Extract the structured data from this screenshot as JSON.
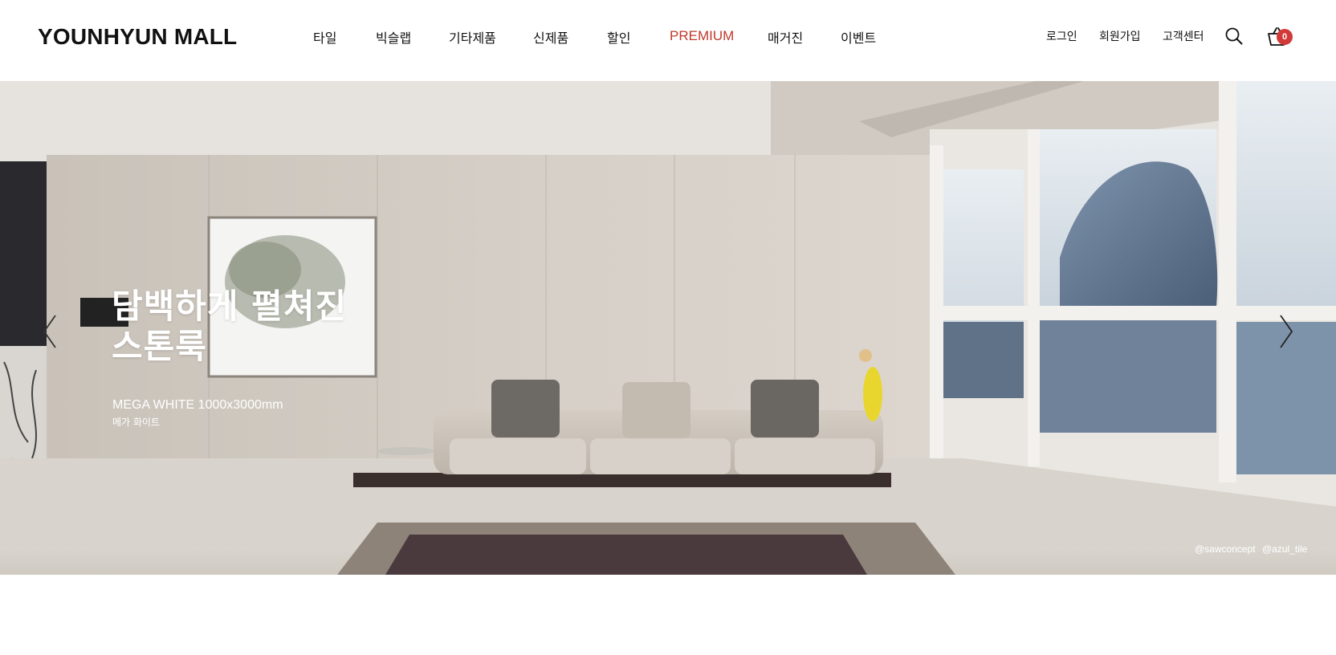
{
  "brand": {
    "logo": "YOUNHYUN MALL",
    "accent_color": "#c0392b"
  },
  "nav": {
    "items": [
      {
        "label": "타일"
      },
      {
        "label": "빅슬랩"
      },
      {
        "label": "기타제품"
      },
      {
        "label": "신제품"
      },
      {
        "label": "할인"
      },
      {
        "label": "PREMIUM",
        "highlight": true
      },
      {
        "label": "매거진"
      },
      {
        "label": "이벤트"
      }
    ]
  },
  "utility": {
    "login": "로그인",
    "signup": "회원가입",
    "support": "고객센터",
    "search_icon": "search-icon",
    "cart_icon": "cart-icon",
    "cart_count": "0",
    "badge_color": "#d23a3a"
  },
  "hero": {
    "title_line1": "담백하게 펼쳐진",
    "title_line2": "스톤룩",
    "product_name": "MEGA WHITE 1000x3000mm",
    "product_name_kr": "메가 화이트",
    "credit_1": "@sawconcept",
    "credit_2": "@azul_tile",
    "prev_icon": "chevron-left-icon",
    "next_icon": "chevron-right-icon"
  }
}
